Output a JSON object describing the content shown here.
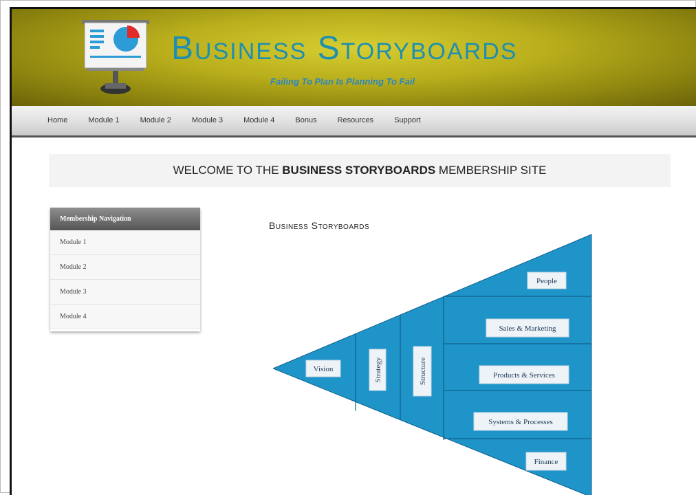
{
  "header": {
    "title": "Business Storyboards",
    "tagline": "Failing To Plan Is Planning To Fail"
  },
  "nav": {
    "items": [
      "Home",
      "Module 1",
      "Module 2",
      "Module 3",
      "Module 4",
      "Bonus",
      "Resources",
      "Support"
    ]
  },
  "welcome": {
    "prefix": "WELCOME TO THE ",
    "bold": "BUSINESS STORYBOARDS",
    "suffix": " MEMBERSHIP SITE"
  },
  "sidebar": {
    "heading": "Membership Navigation",
    "items": [
      "Module 1",
      "Module 2",
      "Module 3",
      "Module 4"
    ]
  },
  "diagram": {
    "title": "Business Storyboards",
    "labels": {
      "vision": "Vision",
      "strategy": "Strategy",
      "structure": "Structure",
      "people": "People",
      "sales": "Sales & Marketing",
      "products": "Products & Services",
      "systems": "Systems & Processes",
      "finance": "Finance"
    },
    "color": "#1e94c9",
    "line_color": "#0f5f8c"
  },
  "colors": {
    "header_gold": "#b9ae1c",
    "title_blue": "#1d8fb0"
  }
}
